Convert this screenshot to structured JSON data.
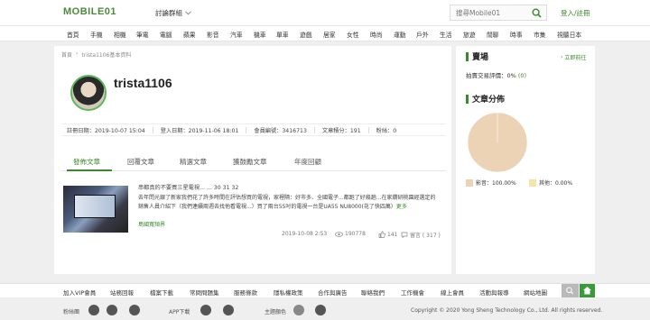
{
  "header": {
    "logo": "MOBILE01",
    "forum_dropdown": "討論群組",
    "search_placeholder": "搜尋Mobile01",
    "login_label": "登入/註冊"
  },
  "nav": {
    "items": [
      "首頁",
      "手機",
      "相機",
      "筆電",
      "電腦",
      "蘋果",
      "影音",
      "汽車",
      "機車",
      "單車",
      "遊戲",
      "居家",
      "女性",
      "時尚",
      "運動",
      "戶外",
      "生活",
      "旅遊",
      "閒聊",
      "時事",
      "市集",
      "視聽日本"
    ]
  },
  "breadcrumb": {
    "home": "首頁",
    "sep": "›",
    "current": "trista1106基本資料"
  },
  "profile": {
    "username": "trista1106",
    "stats": [
      "註冊日期：2019-10-07 15:04",
      "登入日期：2019-11-06 18:01",
      "會員編號：3416713",
      "文章積分：191",
      "粉絲：0"
    ]
  },
  "tabs": [
    "發佈文章",
    "回覆文章",
    "精選文章",
    "獲鼓勵文章",
    "年度回顧"
  ],
  "post": {
    "title": "串都真的不要買三星電視... ... 30 31 32",
    "body": "去年問光銀了新家我們花了許多時間在評估想買的電視，家裡隔：好市多、全國電子...都跑了好幾趟...在家鑽研桃園經選定的銷售人員介紹下（我們連續兩週去找他看電視...）買了兩台55吋的電視一台是UA55 NU8000(花了快四萬）",
    "more": "更多",
    "forum": "島國寬頻界",
    "date": "2019-10-08 2:53",
    "views": "190778",
    "likes": "141",
    "replies": "留言 ( 317 )"
  },
  "sidebar": {
    "market_title": "賣場",
    "more_link": "立即前往",
    "rating_text": "拍賣交易評價：",
    "rating_value": "0%",
    "rating_count": "(0)",
    "dist_title": "文章分佈",
    "legend": [
      {
        "label": "影音：100.00%",
        "color": "#ecd3b5"
      },
      {
        "label": "其他：0.00%",
        "color": "#f3e6a7"
      }
    ]
  },
  "chart_data": {
    "type": "pie",
    "categories": [
      "影音",
      "其他"
    ],
    "values": [
      100.0,
      0.0
    ],
    "colors": [
      "#ecd3b5",
      "#f3e6a7"
    ]
  },
  "footer": {
    "links": [
      "加入VIP會員",
      "站務回報",
      "檔案下載",
      "常問問題集",
      "服務條款",
      "隱私權政策",
      "合作與廣告",
      "聯絡我們",
      "工作機會",
      "線上會員",
      "活動與報導",
      "網站地圖"
    ],
    "fans_label": "粉絲團",
    "app_label": "APP下載",
    "theme_label": "主題顏色",
    "copyright": "Copyright © 2020 Yong Sheng Technology Co., Ltd. All rights reserved."
  }
}
